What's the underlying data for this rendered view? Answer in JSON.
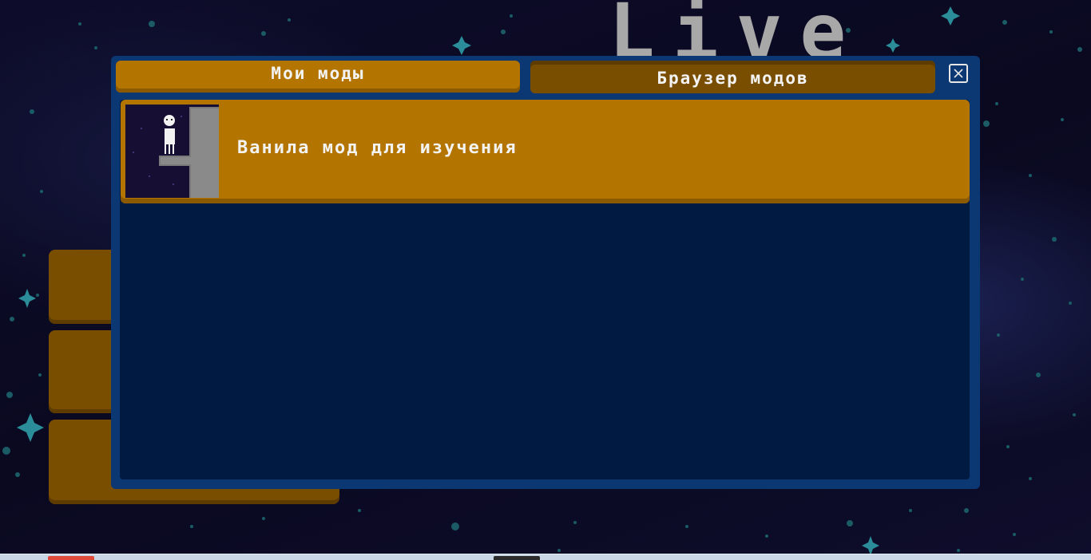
{
  "game": {
    "title_fragment": "Live"
  },
  "mods_window": {
    "tabs": [
      {
        "label": "Мои моды",
        "active": false
      },
      {
        "label": "Браузер модов",
        "active": true
      }
    ],
    "close_icon": "close-icon",
    "mods": [
      {
        "name": "Ванила мод для изучения",
        "thumbnail_icon": "mod-preview-character-icon"
      }
    ]
  },
  "colors": {
    "panel": "#0b3773",
    "panel_inner": "#001a42",
    "button_active": "#b37400",
    "button_inactive": "#7a4e00",
    "text": "#f3f3f3"
  }
}
